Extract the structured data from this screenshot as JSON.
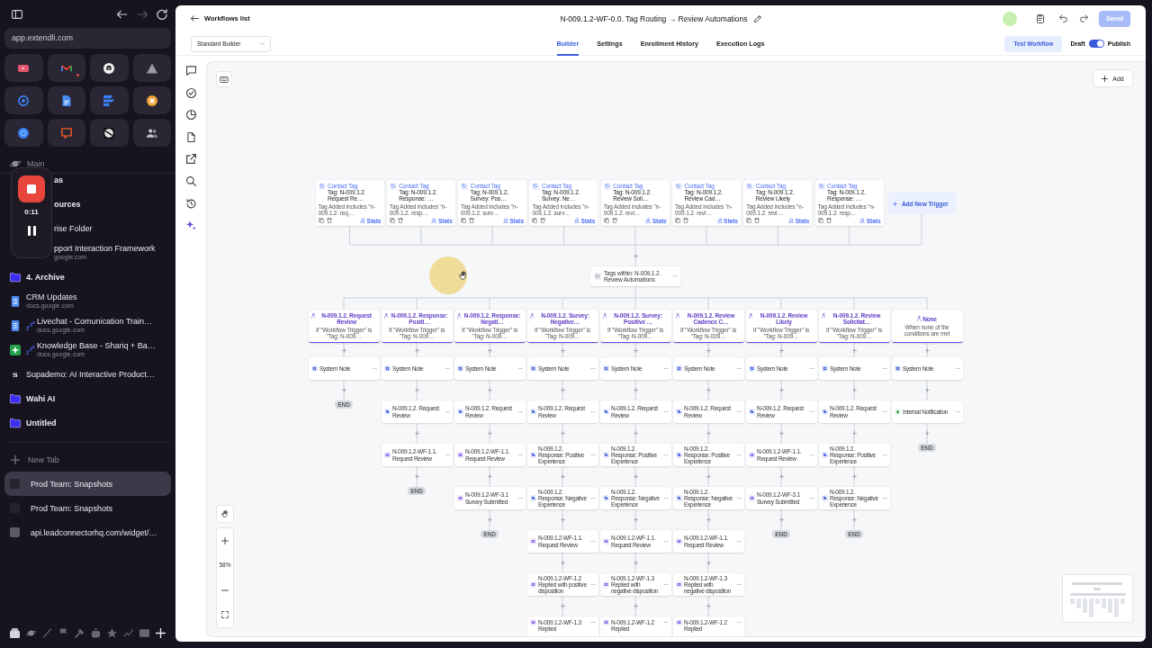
{
  "browser": {
    "url": "app.extendli.com",
    "forward_disabled": true,
    "pinned": [
      {
        "notification": false
      },
      {
        "notification": true
      },
      {
        "notification": false
      },
      {
        "notification": false
      },
      {
        "notification": false
      },
      {
        "notification": false
      },
      {
        "notification": false
      },
      {
        "notification": false
      },
      {
        "notification": false
      },
      {
        "notification": false
      },
      {
        "notification": false
      },
      {
        "notification": false
      }
    ]
  },
  "recording": {
    "time": "0:11"
  },
  "sidebar": {
    "section": "Main",
    "items": [
      {
        "kind": "covered-folder",
        "label": "as",
        "snoozed": false
      },
      {
        "kind": "covered-folder",
        "label": "ources",
        "snoozed": false
      },
      {
        "kind": "covered-page",
        "label": "rise Folder",
        "snoozed": false
      },
      {
        "kind": "covered-page",
        "label": "pport Interaction Framework",
        "sublabel": "google.com",
        "snoozed": false
      },
      {
        "kind": "folder",
        "label": "4. Archive",
        "snoozed": false
      },
      {
        "kind": "doc",
        "label": "CRM Updates",
        "sublabel": "docs.google.com",
        "snoozed": false
      },
      {
        "kind": "doc",
        "label": "Livechat - Comunication Train…",
        "sublabel": "docs.google.com",
        "snoozed": true
      },
      {
        "kind": "sheet",
        "label": "Knowledge Base - Shariq + Ba…",
        "sublabel": "docs.google.com",
        "snoozed": true
      },
      {
        "kind": "site",
        "logo": "S",
        "label": "Supademo: AI Interactive Product…",
        "snoozed": false
      },
      {
        "kind": "folder",
        "label": "Wahi AI",
        "snoozed": false
      },
      {
        "kind": "folder",
        "label": "Untitled",
        "snoozed": false
      }
    ],
    "new_tab": "New Tab",
    "tabs": [
      {
        "label": "Prod Team: Snapshots",
        "selected": true
      },
      {
        "label": "Prod Team: Snapshots",
        "selected": false
      },
      {
        "label": "api.leadconnectorhq.com/widget/…",
        "selected": false
      }
    ]
  },
  "header": {
    "back": "Workflows list",
    "title": "N-009.1.2-WF-0.0. Tag Routing → Review Automations",
    "save": {
      "label": "Saved",
      "disabled": true
    },
    "builder_mode": "Standard Builder",
    "tabs": [
      {
        "label": "Builder",
        "selected": true
      },
      {
        "label": "Settings",
        "selected": false
      },
      {
        "label": "Enrollment History",
        "selected": false
      },
      {
        "label": "Execution Logs",
        "selected": false
      }
    ],
    "test": "Test Workflow",
    "draft_label": "Draft",
    "publish_on": true,
    "publish_label": "Publish"
  },
  "canvas": {
    "add": "Add",
    "zoom": "58%",
    "triggers": [
      {
        "type": "Contact Tag",
        "title": "Tag: N-009.1.2. Request Re…",
        "detail": "Tag Added includes \"n-009.1.2. req…",
        "stats": "Stats"
      },
      {
        "type": "Contact Tag",
        "title": "Tag: N-009.1.2. Response: …",
        "detail": "Tag Added includes \"n-009.1.2. resp…",
        "stats": "Stats"
      },
      {
        "type": "Contact Tag",
        "title": "Tag: N-009.1.2. Survey: Pos…",
        "detail": "Tag Added includes \"n-009.1.2. surv…",
        "stats": "Stats"
      },
      {
        "type": "Contact Tag",
        "title": "Tag: N-009.1.2. Survey: Ne…",
        "detail": "Tag Added includes \"n-009.1.2. surv…",
        "stats": "Stats"
      },
      {
        "type": "Contact Tag",
        "title": "Tag: N-009.1.2. Review Soli…",
        "detail": "Tag Added includes \"n-009.1.2. revi…",
        "stats": "Stats"
      },
      {
        "type": "Contact Tag",
        "title": "Tag: N-009.1.2. Review Cad…",
        "detail": "Tag Added includes \"n-009.1.2. revi…",
        "stats": "Stats"
      },
      {
        "type": "Contact Tag",
        "title": "Tag: N-009.1.2. Review Likely",
        "detail": "Tag Added includes \"n-009.1.2. revi…",
        "stats": "Stats"
      },
      {
        "type": "Contact Tag",
        "title": "Tag: N-009.1.2. Response: …",
        "detail": "Tag Added includes \"n-009.1.2. resp…",
        "stats": "Stats"
      }
    ],
    "add_trigger": "Add New Trigger",
    "router": "Tags within: N-009.1.2. Review Automations",
    "branches": [
      {
        "title": "N-009.1.2. Request Review",
        "condition": "If \"Workflow Trigger\" is \"Tag: N-009…",
        "steps": [
          {
            "kind": "note",
            "label": "System Note"
          }
        ],
        "end": "END"
      },
      {
        "title": "N-009.1.2. Response: Positi…",
        "condition": "If \"Workflow Trigger\" is \"Tag: N-009…",
        "steps": [
          {
            "kind": "note",
            "label": "System Note"
          },
          {
            "kind": "tag",
            "label": "N-009.1.2. Request Review"
          },
          {
            "kind": "workflow",
            "label": "N-009.1.2-WF-1.1. Request Review"
          }
        ],
        "end": "END"
      },
      {
        "title": "N-009.1.2. Response: Negati…",
        "condition": "If \"Workflow Trigger\" is \"Tag: N-009…",
        "steps": [
          {
            "kind": "note",
            "label": "System Note"
          },
          {
            "kind": "tag",
            "label": "N-009.1.2. Request Review"
          },
          {
            "kind": "workflow",
            "label": "N-009.1.2-WF-1.1. Request Review"
          },
          {
            "kind": "workflow",
            "label": "N-009.1.2-WF-3.1 Survey Submitted"
          }
        ],
        "end": "END"
      },
      {
        "title": "N-009.1.2. Survey: Negative…",
        "condition": "If \"Workflow Trigger\" is \"Tag: N-009…",
        "steps": [
          {
            "kind": "note",
            "label": "System Note"
          },
          {
            "kind": "tag",
            "label": "N-009.1.2. Request Review"
          },
          {
            "kind": "tag",
            "label": "N-009.1.2. Response: Positive Experience"
          },
          {
            "kind": "tag",
            "label": "N-009.1.2. Response: Negative Experience"
          },
          {
            "kind": "workflow",
            "label": "N-009.1.2-WF-1.1. Request Review"
          },
          {
            "kind": "workflow",
            "label": "N-009.1.2-WF-1.2 Replied with positive disposition"
          },
          {
            "kind": "workflow",
            "label": "N-009.1.2-WF-1.3 Replied"
          }
        ]
      },
      {
        "title": "N-009.1.2. Survey: Positive …",
        "condition": "If \"Workflow Trigger\" is \"Tag: N-009…",
        "steps": [
          {
            "kind": "note",
            "label": "System Note"
          },
          {
            "kind": "tag",
            "label": "N-009.1.2. Request Review"
          },
          {
            "kind": "tag",
            "label": "N-009.1.2. Response: Positive Experience"
          },
          {
            "kind": "tag",
            "label": "N-009.1.2. Response: Negative Experience"
          },
          {
            "kind": "workflow",
            "label": "N-009.1.2-WF-1.1. Request Review"
          },
          {
            "kind": "workflow",
            "label": "N-009.1.2-WF-1.3 Replied with negative disposition"
          },
          {
            "kind": "workflow",
            "label": "N-009.1.2-WF-1.2 Replied"
          }
        ]
      },
      {
        "title": "N-009.1.2. Review Cadence C…",
        "condition": "If \"Workflow Trigger\" is \"Tag: N-009…",
        "steps": [
          {
            "kind": "note",
            "label": "System Note"
          },
          {
            "kind": "tag",
            "label": "N-009.1.2. Request Review"
          },
          {
            "kind": "tag",
            "label": "N-009.1.2. Response: Positive Experience"
          },
          {
            "kind": "tag",
            "label": "N-009.1.2. Response: Negative Experience"
          },
          {
            "kind": "workflow",
            "label": "N-009.1.2-WF-1.1. Request Review"
          },
          {
            "kind": "workflow",
            "label": "N-009.1.2-WF-1.3 Replied with negative disposition"
          },
          {
            "kind": "workflow",
            "label": "N-009.1.2-WF-1.2 Replied"
          }
        ]
      },
      {
        "title": "N-009.1.2. Review Likely",
        "condition": "If \"Workflow Trigger\" is \"Tag: N-009…",
        "steps": [
          {
            "kind": "note",
            "label": "System Note"
          },
          {
            "kind": "tag",
            "label": "N-009.1.2. Request Review"
          },
          {
            "kind": "workflow",
            "label": "N-009.1.2-WF-1.1. Request Review"
          },
          {
            "kind": "workflow",
            "label": "N-009.1.2-WF-3.1 Survey Submitted"
          }
        ],
        "end": "END"
      },
      {
        "title": "N-009.1.2. Review Solicitat…",
        "condition": "If \"Workflow Trigger\" is \"Tag: N-009…",
        "steps": [
          {
            "kind": "note",
            "label": "System Note"
          },
          {
            "kind": "tag",
            "label": "N-009.1.2. Request Review"
          },
          {
            "kind": "tag",
            "label": "N-009.1.2. Response: Positive Experience"
          },
          {
            "kind": "tag",
            "label": "N-009.1.2. Response: Negative Experience"
          }
        ],
        "end": "END"
      },
      {
        "title": "None",
        "condition": "When none of the conditions are met",
        "steps": [
          {
            "kind": "note",
            "label": "System Note"
          },
          {
            "kind": "notification",
            "label": "Internal Notification"
          }
        ],
        "end": "END"
      }
    ]
  }
}
